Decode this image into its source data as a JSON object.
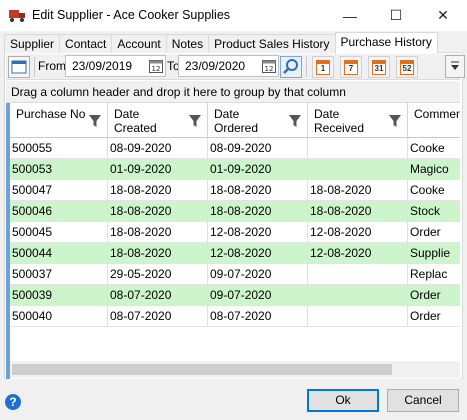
{
  "window": {
    "title": "Edit Supplier - Ace Cooker Supplies",
    "minimize": "—",
    "maximize": "☐",
    "close": "✕"
  },
  "tabs": [
    "Supplier",
    "Contact",
    "Account",
    "Notes",
    "Product Sales History",
    "Purchase History"
  ],
  "toolbar": {
    "from_label": "From",
    "from_date": "23/09/2019",
    "to_label": "To",
    "to_date": "23/09/2020",
    "period_buttons": [
      "1",
      "7",
      "31",
      "52"
    ]
  },
  "group_panel": "Drag a column header and drop it here to group by that column",
  "columns": [
    {
      "label_line1": "Purchase No",
      "label_line2": ""
    },
    {
      "label_line1": "Date",
      "label_line2": "Created"
    },
    {
      "label_line1": "Date",
      "label_line2": "Ordered"
    },
    {
      "label_line1": "Date",
      "label_line2": "Received"
    },
    {
      "label_line1": "Commen",
      "label_line2": ""
    }
  ],
  "rows": [
    [
      "500055",
      "08-09-2020",
      "08-09-2020",
      "",
      "Cooke"
    ],
    [
      "500053",
      "01-09-2020",
      "01-09-2020",
      "",
      "Magico"
    ],
    [
      "500047",
      "18-08-2020",
      "18-08-2020",
      "18-08-2020",
      "Cooke"
    ],
    [
      "500046",
      "18-08-2020",
      "18-08-2020",
      "18-08-2020",
      "Stock"
    ],
    [
      "500045",
      "18-08-2020",
      "12-08-2020",
      "12-08-2020",
      "Order"
    ],
    [
      "500044",
      "18-08-2020",
      "12-08-2020",
      "12-08-2020",
      "Supplie"
    ],
    [
      "500037",
      "29-05-2020",
      "09-07-2020",
      "",
      "Replac"
    ],
    [
      "500039",
      "08-07-2020",
      "09-07-2020",
      "",
      "Order"
    ],
    [
      "500040",
      "08-07-2020",
      "08-07-2020",
      "",
      "Order"
    ]
  ],
  "buttons": {
    "ok": "Ok",
    "cancel": "Cancel",
    "help": "?"
  },
  "colors": {
    "alt_row": "#cdf5cb",
    "accent": "#0078d7"
  }
}
